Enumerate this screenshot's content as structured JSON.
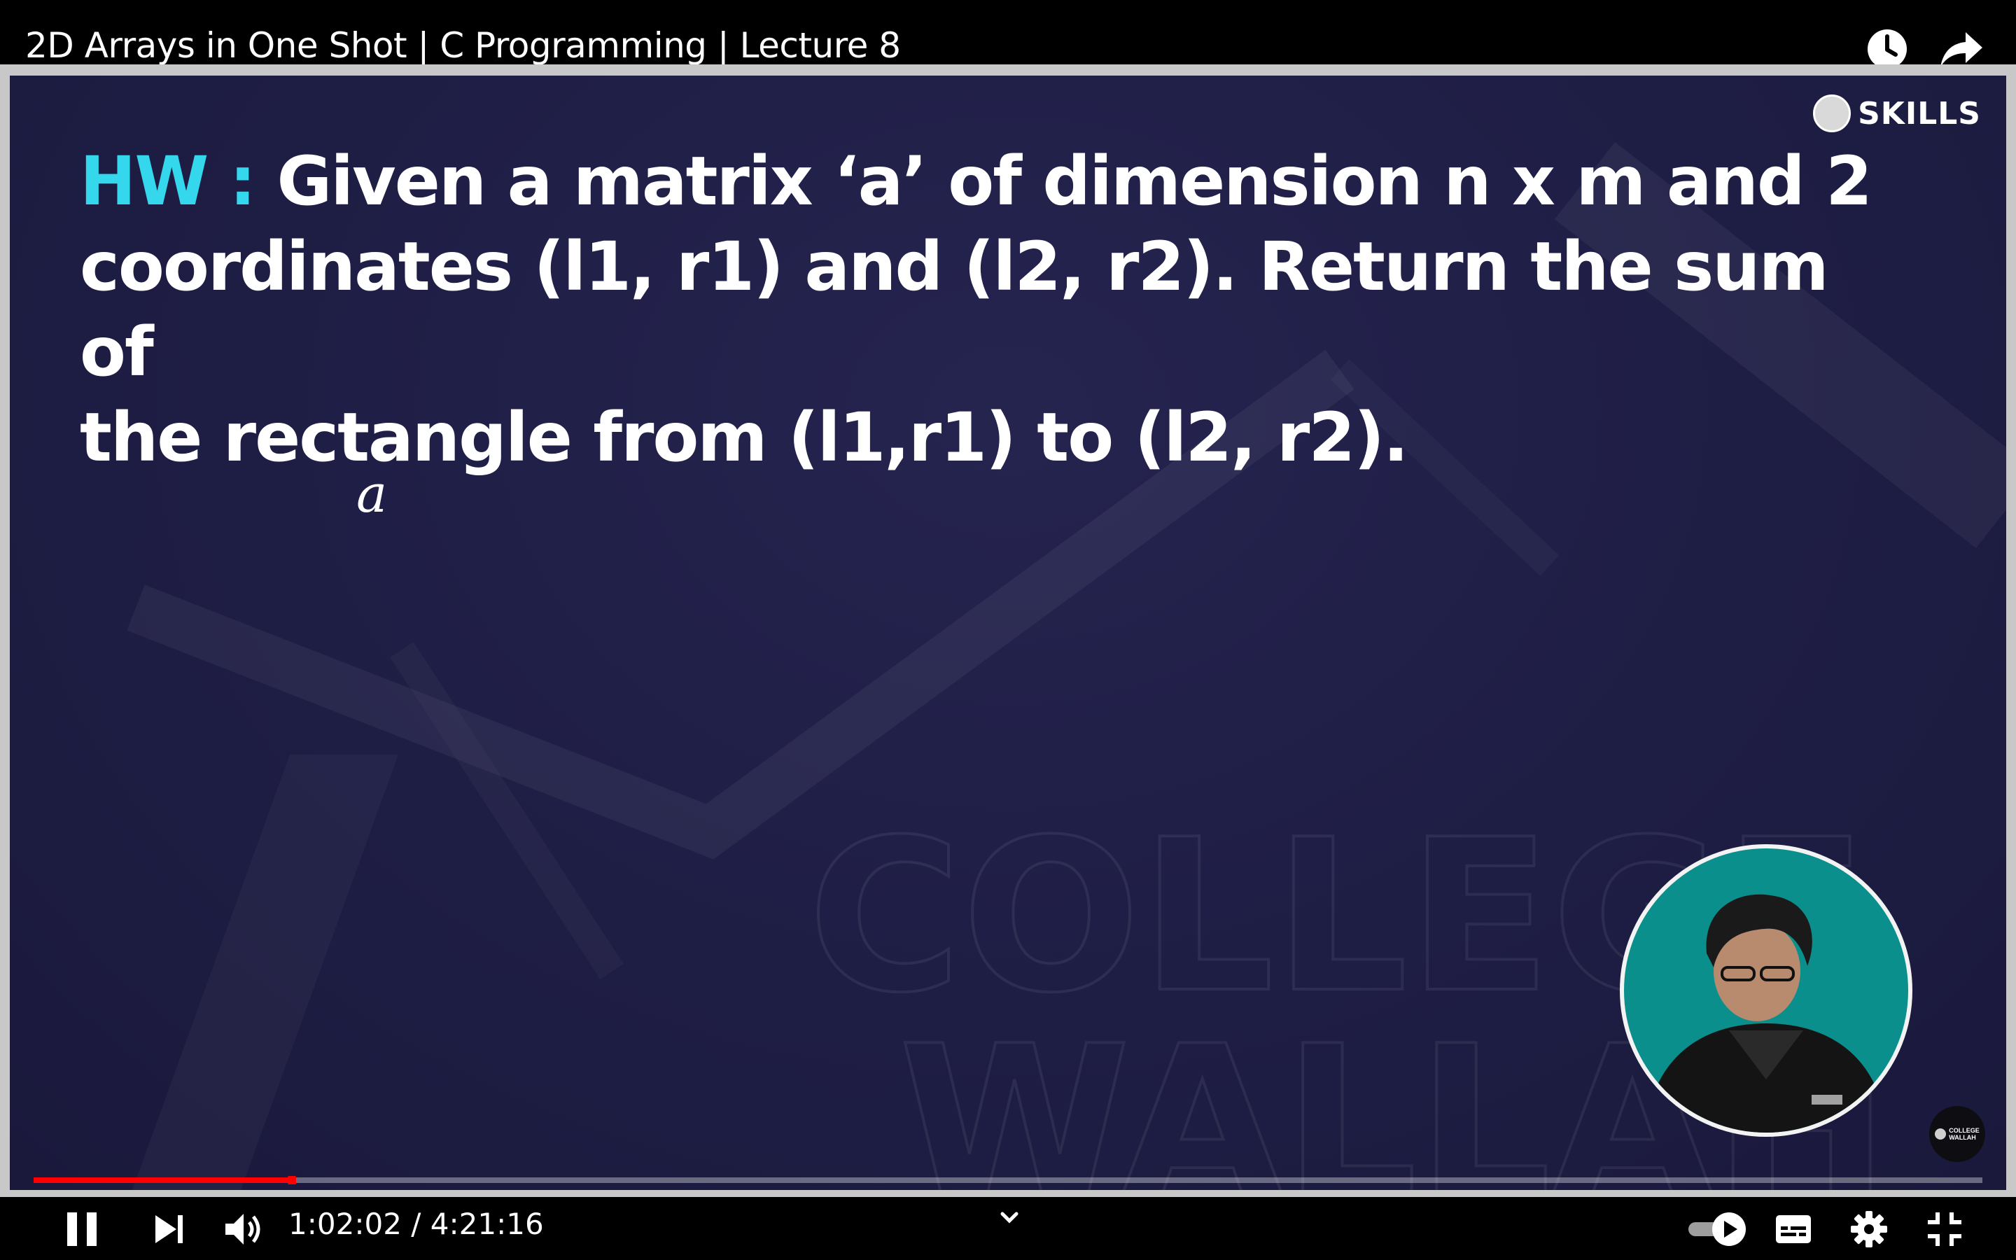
{
  "window": {
    "title": "2D Arrays in One Shot | C Programming | Lecture 8"
  },
  "top_actions": {
    "watch_later_icon": "clock-icon",
    "share_icon": "share-arrow-icon"
  },
  "slide": {
    "hw_label": "HW :",
    "hw_line1": "Given a matrix ‘a’ of dimension n x m and 2",
    "hw_line2": "coordinates (l1, r1) and (l2, r2). Return the sum of",
    "hw_line3": "the rectangle from (l1,r1) to (l2, r2).",
    "handwritten": "a",
    "brand": "SKILLS",
    "watermark_line1": "COLLEGE",
    "watermark_line2": "WALLAH",
    "badge_line1": "COLLEGE",
    "badge_line2": "WALLAH",
    "accent_color": "#35d7ec",
    "background_color": "#1f1e45"
  },
  "player": {
    "progress": 0.131,
    "progress_color": "#ff0000",
    "time_display": "1:02:02 / 4:21:16",
    "autoplay_on": true,
    "icons": {
      "pause": "pause-icon",
      "next": "next-icon",
      "volume": "volume-icon",
      "chevron": "chevron-down-icon",
      "autoplay": "autoplay-toggle-icon",
      "subtitles": "subtitles-icon",
      "settings": "gear-icon",
      "fullscreen_exit": "exit-fullscreen-icon"
    }
  }
}
